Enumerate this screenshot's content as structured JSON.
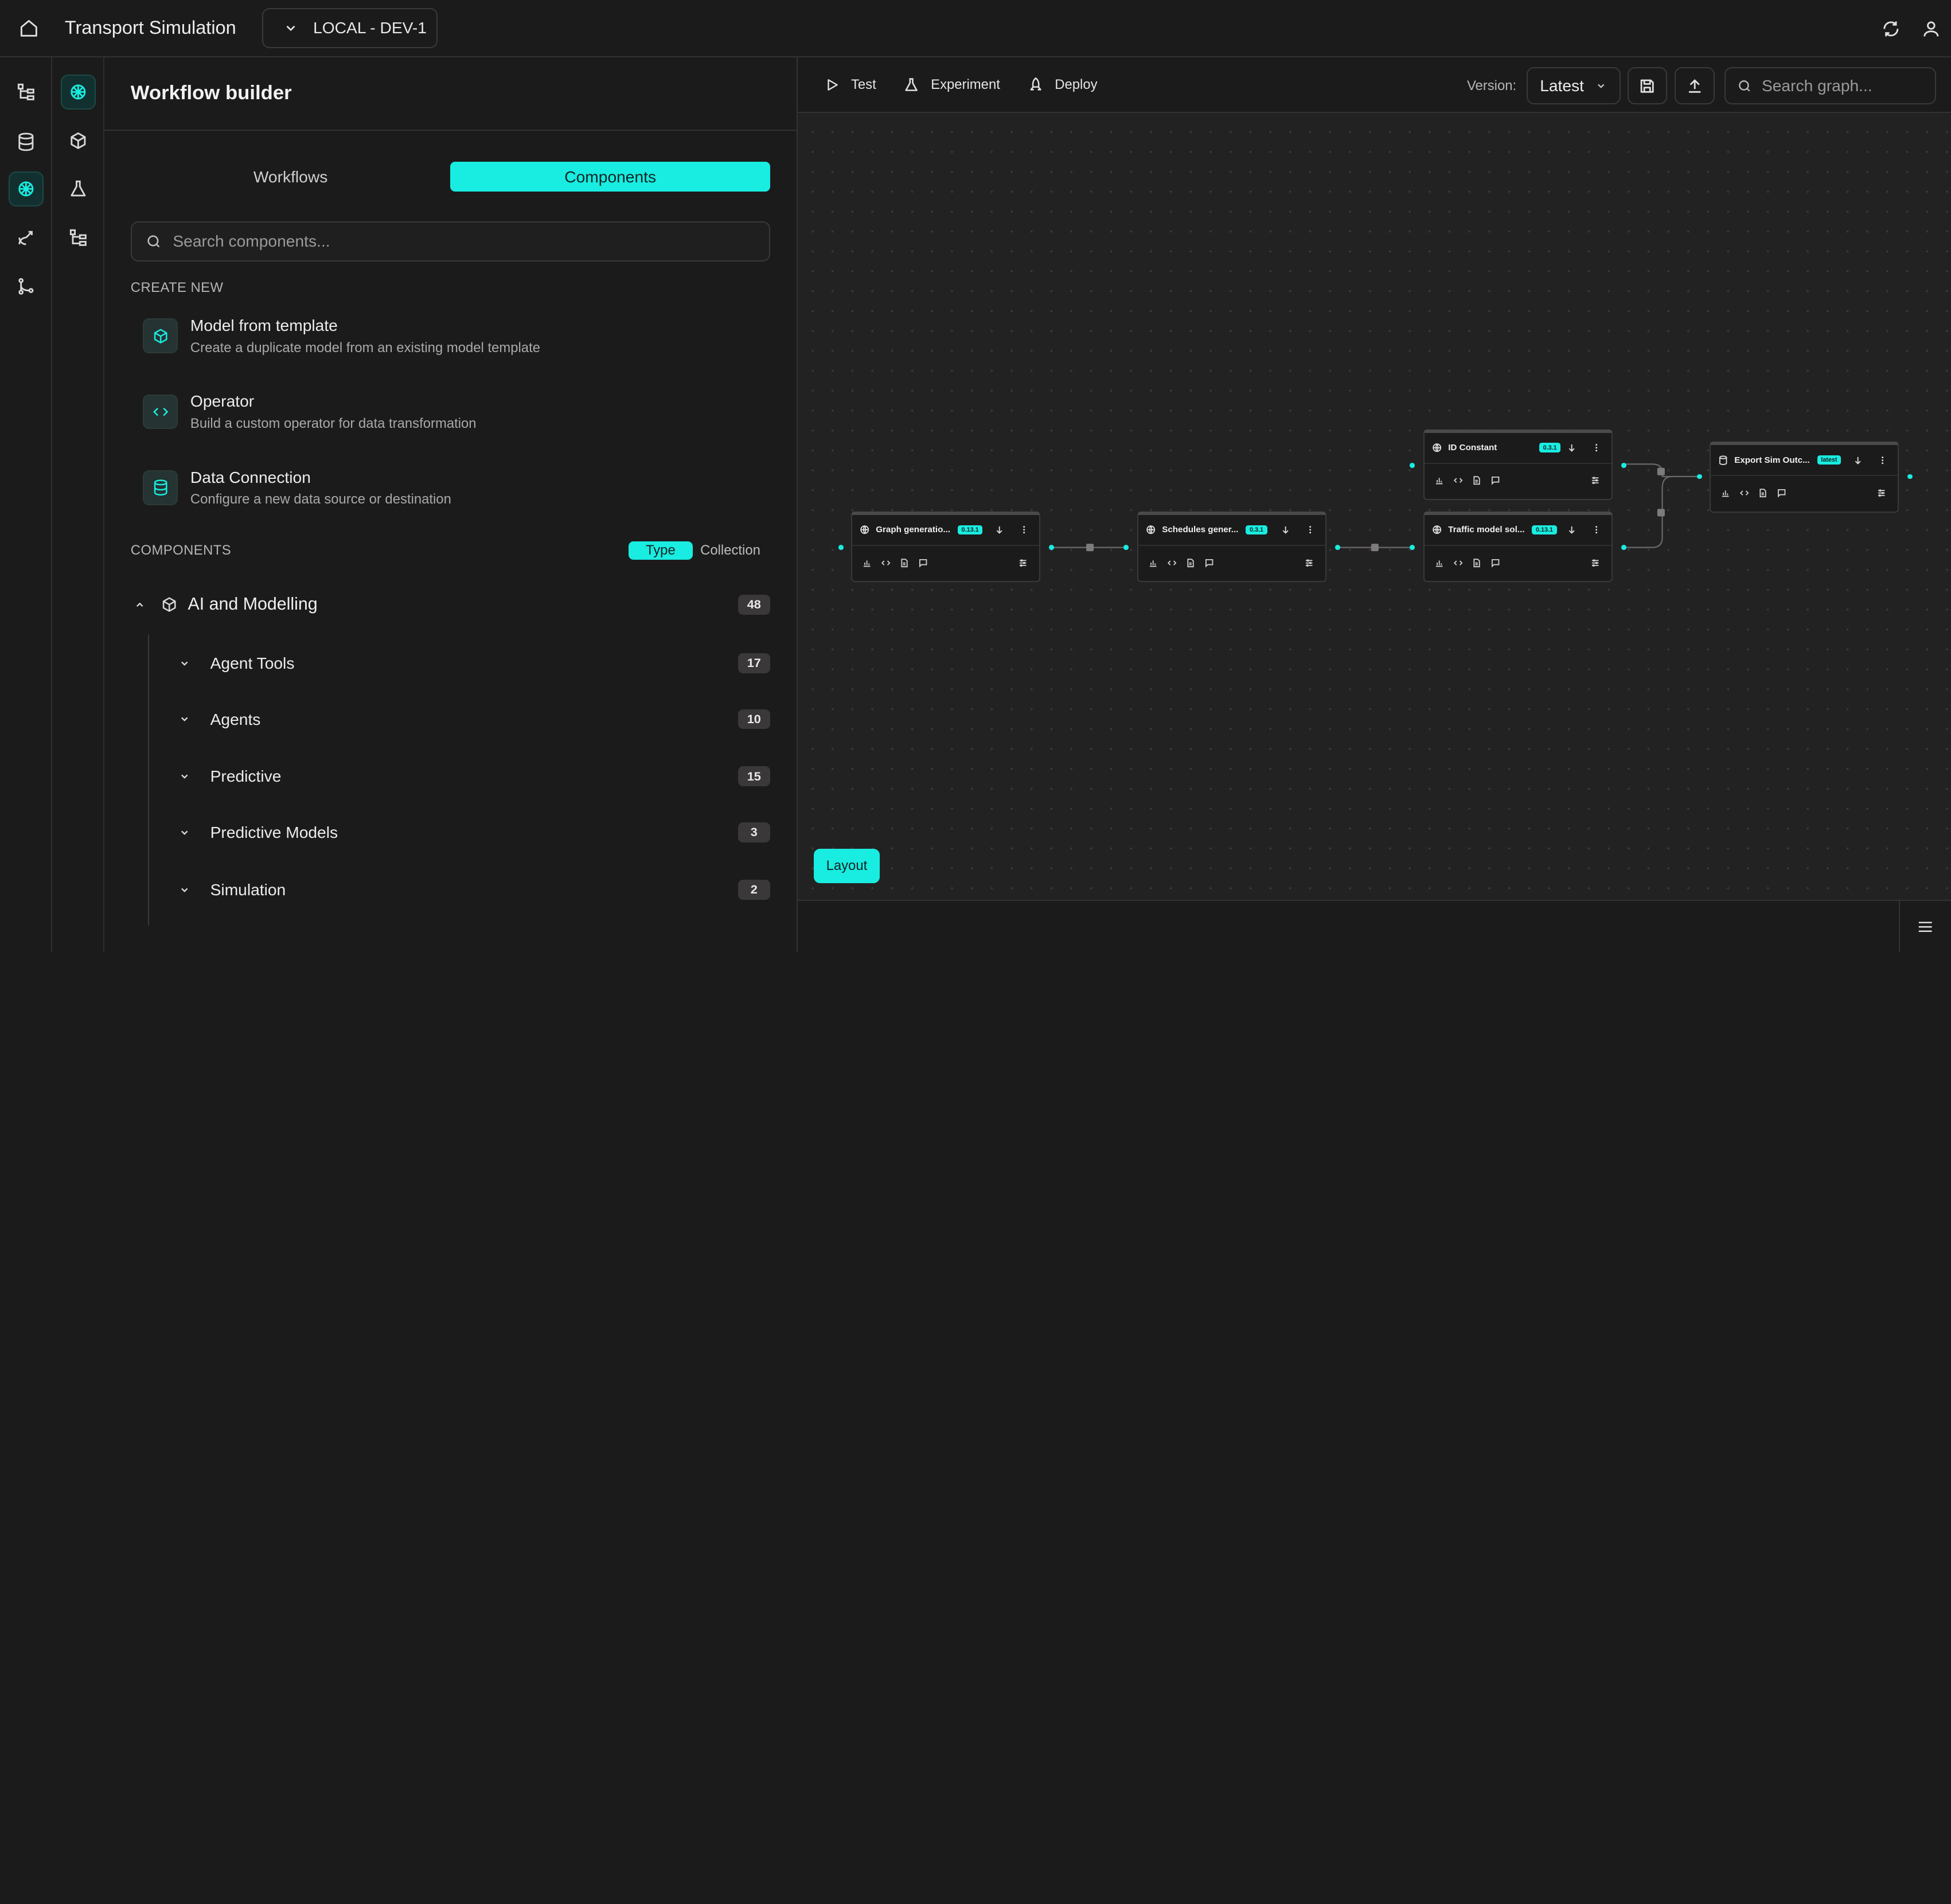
{
  "app": {
    "title": "Transport Simulation",
    "environment": "LOCAL - DEV-1"
  },
  "panel": {
    "title": "Workflow builder",
    "tabs": [
      {
        "label": "Workflows",
        "active": false
      },
      {
        "label": "Components",
        "active": true
      }
    ],
    "search_placeholder": "Search components...",
    "create_new_label": "CREATE NEW",
    "create_items": [
      {
        "icon": "cube-icon",
        "title": "Model from template",
        "description": "Create a duplicate model from an existing model template"
      },
      {
        "icon": "code-icon",
        "title": "Operator",
        "description": "Build a custom operator for data transformation"
      },
      {
        "icon": "database-icon",
        "title": "Data Connection",
        "description": "Configure a new data source or destination"
      }
    ],
    "components_label": "COMPONENTS",
    "view_toggle": {
      "type": "Type",
      "collection": "Collection",
      "active": "Type"
    },
    "group": {
      "name": "AI and Modelling",
      "count": "48",
      "expanded": true
    },
    "subgroups": [
      {
        "name": "Agent Tools",
        "count": "17"
      },
      {
        "name": "Agents",
        "count": "10"
      },
      {
        "name": "Predictive",
        "count": "15"
      },
      {
        "name": "Predictive Models",
        "count": "3"
      },
      {
        "name": "Simulation",
        "count": "2"
      }
    ]
  },
  "toolbar": {
    "test": "Test",
    "experiment": "Experiment",
    "deploy": "Deploy",
    "version_label": "Version:",
    "version_value": "Latest",
    "search_placeholder": "Search graph..."
  },
  "nodes": [
    {
      "title": "Graph generatio...",
      "version": "0.13.1"
    },
    {
      "title": "Schedules gener...",
      "version": "0.3.1"
    },
    {
      "title": "ID Constant",
      "version": "0.3.1"
    },
    {
      "title": "Traffic model sol...",
      "version": "0.13.1"
    },
    {
      "title": "Export Sim Outc...",
      "version": "latest"
    }
  ],
  "canvas": {
    "layout_button": "Layout"
  },
  "colors": {
    "accent": "#19ece0",
    "background": "#1c1b1b",
    "canvas": "#232222"
  }
}
